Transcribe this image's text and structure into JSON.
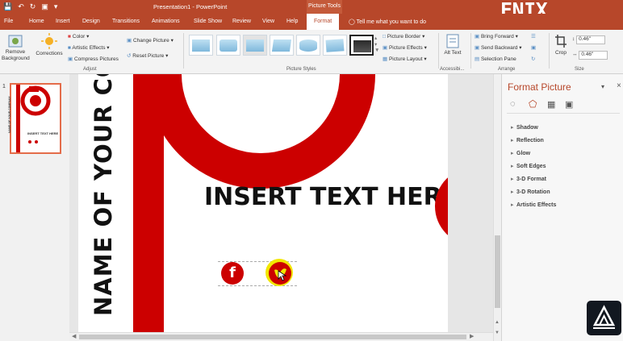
{
  "window": {
    "title": "Presentation1 - PowerPoint",
    "context_title": "Picture Tools",
    "brand": "ENIX Tutorial"
  },
  "tabs": [
    {
      "label": "File"
    },
    {
      "label": "Home"
    },
    {
      "label": "Insert"
    },
    {
      "label": "Design"
    },
    {
      "label": "Transitions"
    },
    {
      "label": "Animations"
    },
    {
      "label": "Slide Show"
    },
    {
      "label": "Review"
    },
    {
      "label": "View"
    },
    {
      "label": "Help"
    },
    {
      "label": "Format"
    }
  ],
  "tell_me": "Tell me what you want to do",
  "ribbon": {
    "remove_background": "Remove Background",
    "corrections": "Corrections",
    "color": "Color",
    "artistic_effects": "Artistic Effects",
    "compress_pictures": "Compress Pictures",
    "change_picture": "Change Picture",
    "reset_picture": "Reset Picture",
    "adjust_label": "Adjust",
    "picture_border": "Picture Border",
    "picture_effects": "Picture Effects",
    "picture_layout": "Picture Layout",
    "picture_styles_label": "Picture Styles",
    "alt_text": "Alt Text",
    "accessibility_label": "Accessibi...",
    "bring_forward": "Bring Forward",
    "send_backward": "Send Backward",
    "selection_pane": "Selection Pane",
    "arrange_label": "Arrange",
    "crop": "Crop",
    "height": "0.46\"",
    "width": "0.46\"",
    "size_label": "Size"
  },
  "slide_panel": {
    "slide_number": "1",
    "thumb_company": "NAME OF YOUR COMPANY",
    "thumb_text": "INSERT TEXT HERE"
  },
  "slide": {
    "vertical_text": "NAME OF YOUR CO",
    "headline": "INSERT TEXT HERE",
    "facebook_letter": "f"
  },
  "format_pane": {
    "title": "Format Picture",
    "sections": [
      {
        "label": "Shadow"
      },
      {
        "label": "Reflection"
      },
      {
        "label": "Glow"
      },
      {
        "label": "Soft Edges"
      },
      {
        "label": "3-D Format"
      },
      {
        "label": "3-D Rotation"
      },
      {
        "label": "Artistic Effects"
      }
    ]
  },
  "colors": {
    "accent": "#b7472a",
    "brand_red": "#cc0000"
  }
}
